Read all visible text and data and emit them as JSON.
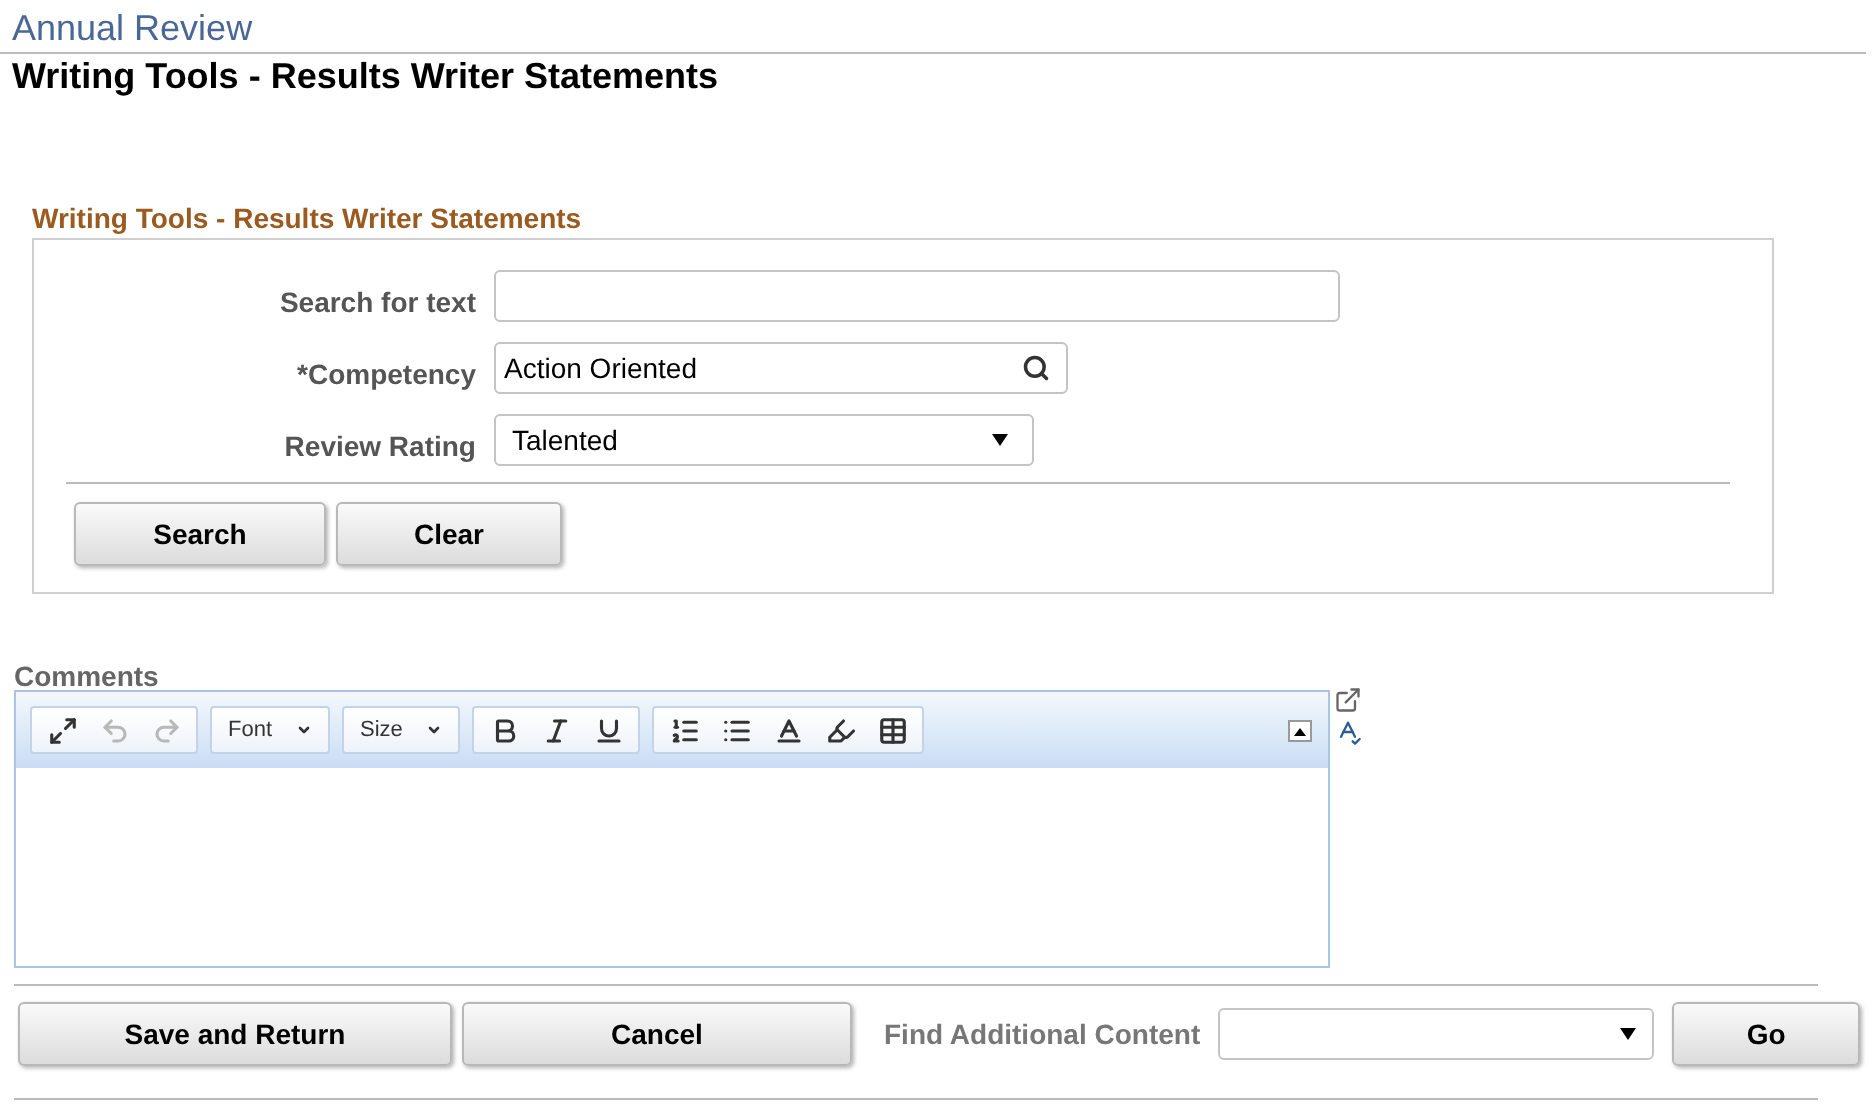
{
  "breadcrumb": "Annual Review",
  "page_title": "Writing Tools - Results Writer Statements",
  "section": {
    "title": "Writing Tools - Results Writer Statements",
    "fields": [
      {
        "kind": "text",
        "label": "Search for text"
      },
      {
        "kind": "lookup",
        "label": "*Competency",
        "value": "Action Oriented"
      },
      {
        "kind": "select",
        "label": "Review Rating",
        "value": "Talented"
      }
    ],
    "buttons": [
      "Search",
      "Clear"
    ]
  },
  "comments": {
    "label": "Comments",
    "toolbar": [
      [
        {
          "kind": "button",
          "disabled": false
        },
        {
          "kind": "button",
          "disabled": true
        },
        {
          "kind": "button",
          "disabled": true
        }
      ],
      [
        {
          "kind": "dropdown",
          "label": "Font"
        }
      ],
      [
        {
          "kind": "dropdown",
          "label": "Size"
        }
      ],
      [
        {
          "kind": "button",
          "disabled": false
        },
        {
          "kind": "button",
          "disabled": false
        },
        {
          "kind": "button",
          "disabled": false
        }
      ],
      [
        {
          "kind": "button",
          "disabled": false
        },
        {
          "kind": "button",
          "disabled": false
        },
        {
          "kind": "button",
          "disabled": false
        },
        {
          "kind": "button",
          "disabled": false
        },
        {
          "kind": "button",
          "disabled": false
        }
      ]
    ]
  },
  "footer": {
    "buttons": [
      "Save and Return",
      "Cancel"
    ],
    "find_label": "Find Additional Content",
    "go": "Go"
  }
}
